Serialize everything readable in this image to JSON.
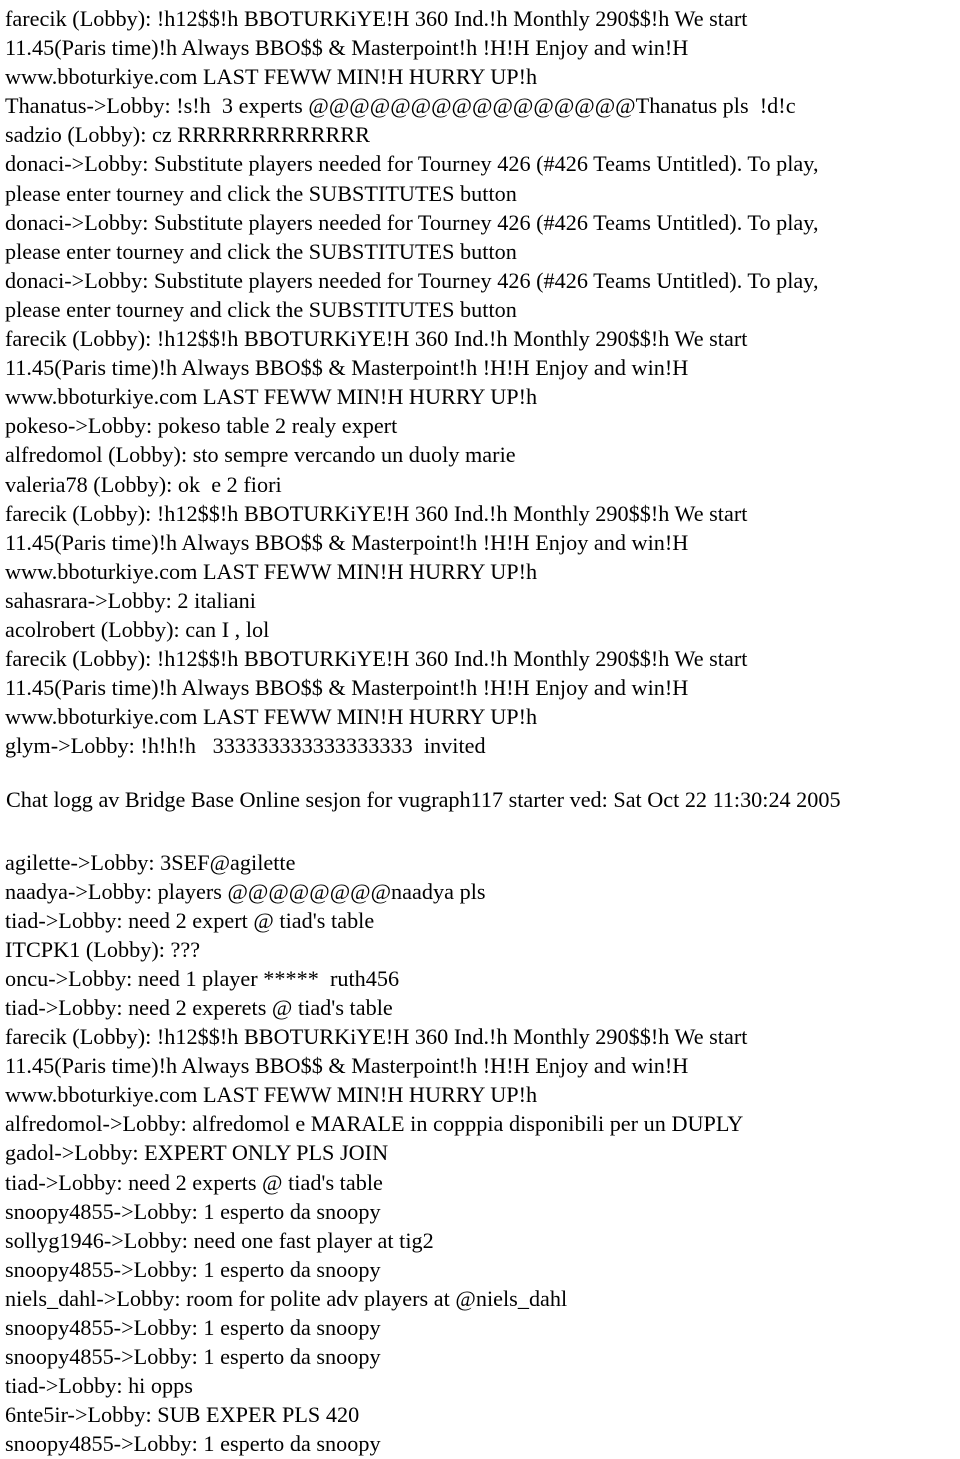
{
  "document": {
    "type": "chat-log",
    "title": "Chat logg av Bridge Base Online sesjon for vugraph117 starter ved: Sat Oct 22 11:30:24 2005",
    "background_color": "#ffffff",
    "text_color": "#000000"
  },
  "section_top": {
    "lines": [
      "farecik (Lobby): !h12$$!h BBOTURKiYE!H 360 Ind.!h Monthly 290$$!h We start",
      "11.45(Paris time)!h Always BBO$$ & Masterpoint!h !H!H Enjoy and win!H",
      "www.bboturkiye.com LAST FEWW MIN!H HURRY UP!h",
      "Thanatus->Lobby: !s!h  3 experts @@@@@@@@@@@@@@@@Thanatus pls  !d!c",
      "sadzio (Lobby): cz RRRRRRRRRRRRR",
      "donaci->Lobby: Substitute players needed for Tourney 426 (#426 Teams Untitled). To play,",
      "please enter tourney and click the SUBSTITUTES button",
      "donaci->Lobby: Substitute players needed for Tourney 426 (#426 Teams Untitled). To play,",
      "please enter tourney and click the SUBSTITUTES button",
      "donaci->Lobby: Substitute players needed for Tourney 426 (#426 Teams Untitled). To play,",
      "please enter tourney and click the SUBSTITUTES button",
      "farecik (Lobby): !h12$$!h BBOTURKiYE!H 360 Ind.!h Monthly 290$$!h We start",
      "11.45(Paris time)!h Always BBO$$ & Masterpoint!h !H!H Enjoy and win!H",
      "www.bboturkiye.com LAST FEWW MIN!H HURRY UP!h",
      "pokeso->Lobby: pokeso table 2 realy expert",
      "alfredomol (Lobby): sto sempre vercando un duoly marie",
      "valeria78 (Lobby): ok  e 2 fiori",
      "farecik (Lobby): !h12$$!h BBOTURKiYE!H 360 Ind.!h Monthly 290$$!h We start",
      "11.45(Paris time)!h Always BBO$$ & Masterpoint!h !H!H Enjoy and win!H",
      "www.bboturkiye.com LAST FEWW MIN!H HURRY UP!h",
      "sahasrara->Lobby: 2 italiani",
      "acolrobert (Lobby): can I , lol",
      "farecik (Lobby): !h12$$!h BBOTURKiYE!H 360 Ind.!h Monthly 290$$!h We start",
      "11.45(Paris time)!h Always BBO$$ & Masterpoint!h !H!H Enjoy and win!H",
      "www.bboturkiye.com LAST FEWW MIN!H HURRY UP!h",
      "glym->Lobby: !h!h!h   333333333333333333  invited"
    ]
  },
  "section_bottom": {
    "lines": [
      "agilette->Lobby: 3SEF@agilette",
      "naadya->Lobby: players @@@@@@@@naadya pls",
      "tiad->Lobby: need 2 expert @ tiad's table",
      "ITCPK1 (Lobby): ???",
      "oncu->Lobby: need 1 player *****  ruth456",
      "tiad->Lobby: need 2 experets @ tiad's table",
      "farecik (Lobby): !h12$$!h BBOTURKiYE!H 360 Ind.!h Monthly 290$$!h We start",
      "11.45(Paris time)!h Always BBO$$ & Masterpoint!h !H!H Enjoy and win!H",
      "www.bboturkiye.com LAST FEWW MIN!H HURRY UP!h",
      "alfredomol->Lobby: alfredomol e MARALE in copppia disponibili per un DUPLY",
      "gadol->Lobby: EXPERT ONLY PLS JOIN",
      "tiad->Lobby: need 2 experts @ tiad's table",
      "snoopy4855->Lobby: 1 esperto da snoopy",
      "sollyg1946->Lobby: need one fast player at tig2",
      "snoopy4855->Lobby: 1 esperto da snoopy",
      "niels_dahl->Lobby: room for polite adv players at @niels_dahl",
      "snoopy4855->Lobby: 1 esperto da snoopy",
      "snoopy4855->Lobby: 1 esperto da snoopy",
      "tiad->Lobby: hi opps",
      "6nte5ir->Lobby: SUB EXPER PLS 420",
      "snoopy4855->Lobby: 1 esperto da snoopy"
    ]
  }
}
